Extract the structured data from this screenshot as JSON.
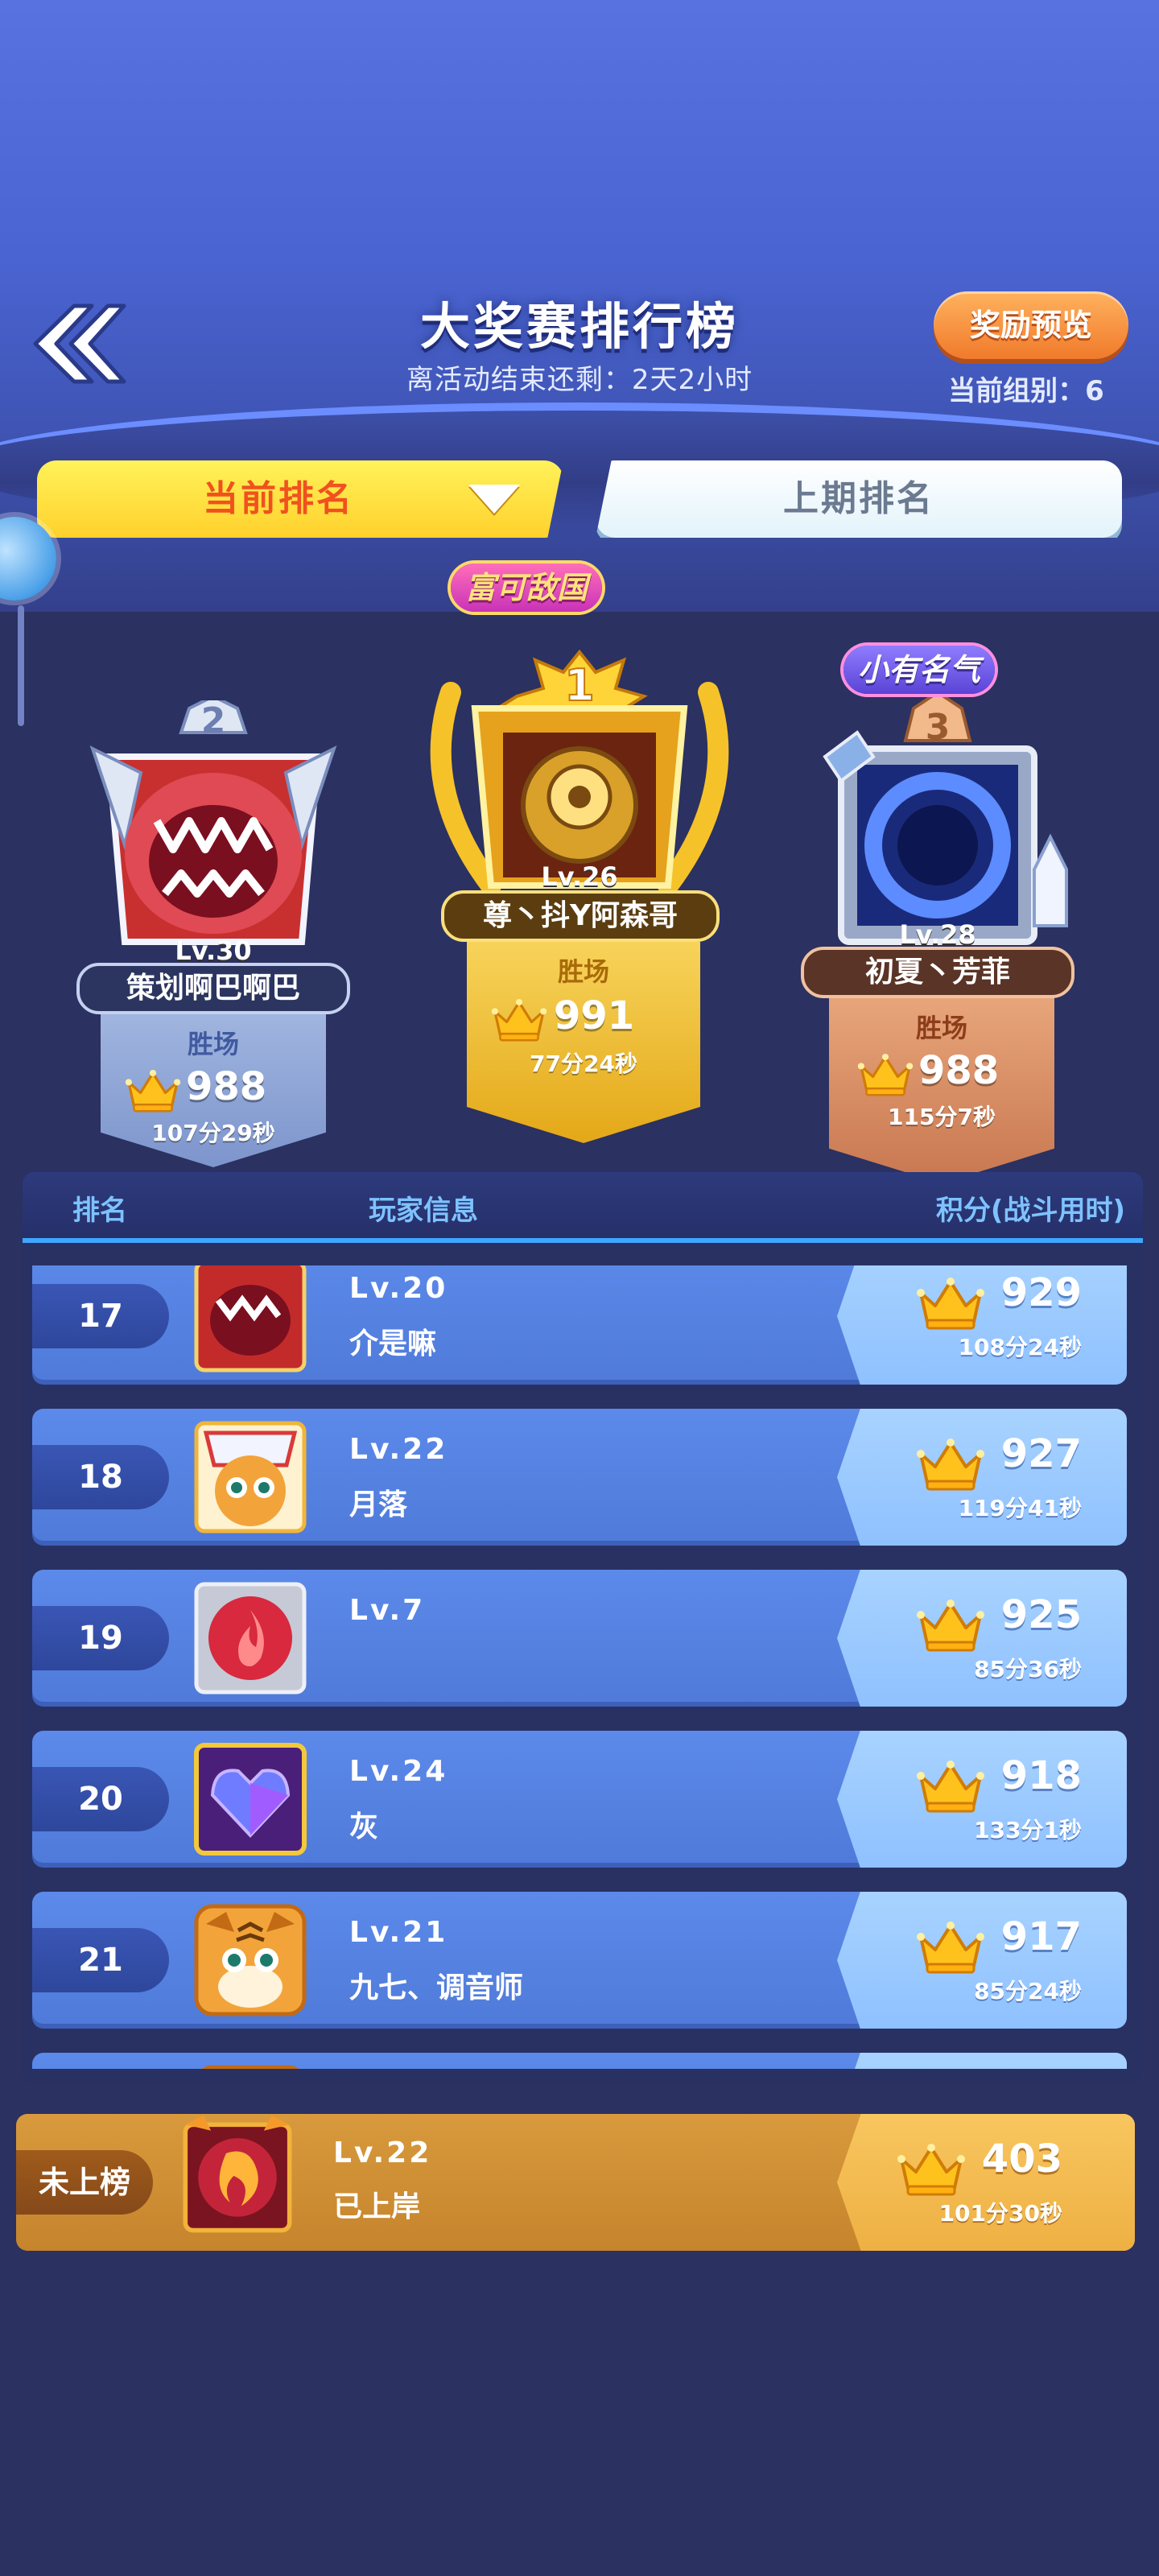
{
  "header": {
    "title": "大奖赛排行榜",
    "countdown": "离活动结束还剩：2天2小时",
    "reward_button": "奖励预览",
    "group": "当前组别：6"
  },
  "tabs": [
    {
      "label": "当前排名",
      "active": true
    },
    {
      "label": "上期排名",
      "active": false
    }
  ],
  "podium": {
    "first": {
      "rank": "1",
      "badge": "富可敌国",
      "level": "Lv.26",
      "name": "尊丶抖Y阿森哥",
      "label": "胜场",
      "score": "991",
      "time": "77分24秒"
    },
    "second": {
      "rank": "2",
      "level": "Lv.30",
      "name": "策划啊巴啊巴",
      "label": "胜场",
      "score": "988",
      "time": "107分29秒"
    },
    "third": {
      "rank": "3",
      "badge": "小有名气",
      "level": "Lv.28",
      "name": "初夏丶芳菲",
      "label": "胜场",
      "score": "988",
      "time": "115分7秒"
    }
  },
  "list": {
    "columns": {
      "rank": "排名",
      "player": "玩家信息",
      "score": "积分(战斗用时)"
    },
    "rows": [
      {
        "rank": "17",
        "level": "Lv.20",
        "name": "介是嘛",
        "score": "929",
        "time": "108分24秒",
        "avatar": "red-monster-avatar"
      },
      {
        "rank": "18",
        "level": "Lv.22",
        "name": "月落",
        "score": "927",
        "time": "119分41秒",
        "avatar": "tiger-helmet-avatar"
      },
      {
        "rank": "19",
        "level": "Lv.7",
        "name": "",
        "score": "925",
        "time": "85分36秒",
        "avatar": "fire-orb-avatar"
      },
      {
        "rank": "20",
        "level": "Lv.24",
        "name": "灰",
        "score": "918",
        "time": "133分1秒",
        "avatar": "crystal-heart-avatar"
      },
      {
        "rank": "21",
        "level": "Lv.21",
        "name": "九七、调音师",
        "score": "917",
        "time": "85分24秒",
        "avatar": "tiger-avatar"
      },
      {
        "rank": "",
        "level": "",
        "name": "",
        "score": "",
        "time": "",
        "avatar": "tiger-avatar"
      }
    ]
  },
  "my_rank": {
    "rank": "未上榜",
    "level": "Lv.22",
    "name": "已上岸",
    "score": "403",
    "time": "101分30秒",
    "avatar": "phoenix-avatar"
  },
  "colors": {
    "accent_gold": "#ffd12c",
    "list_blue": "#5c8aea",
    "my_row": "#d89a3d"
  }
}
